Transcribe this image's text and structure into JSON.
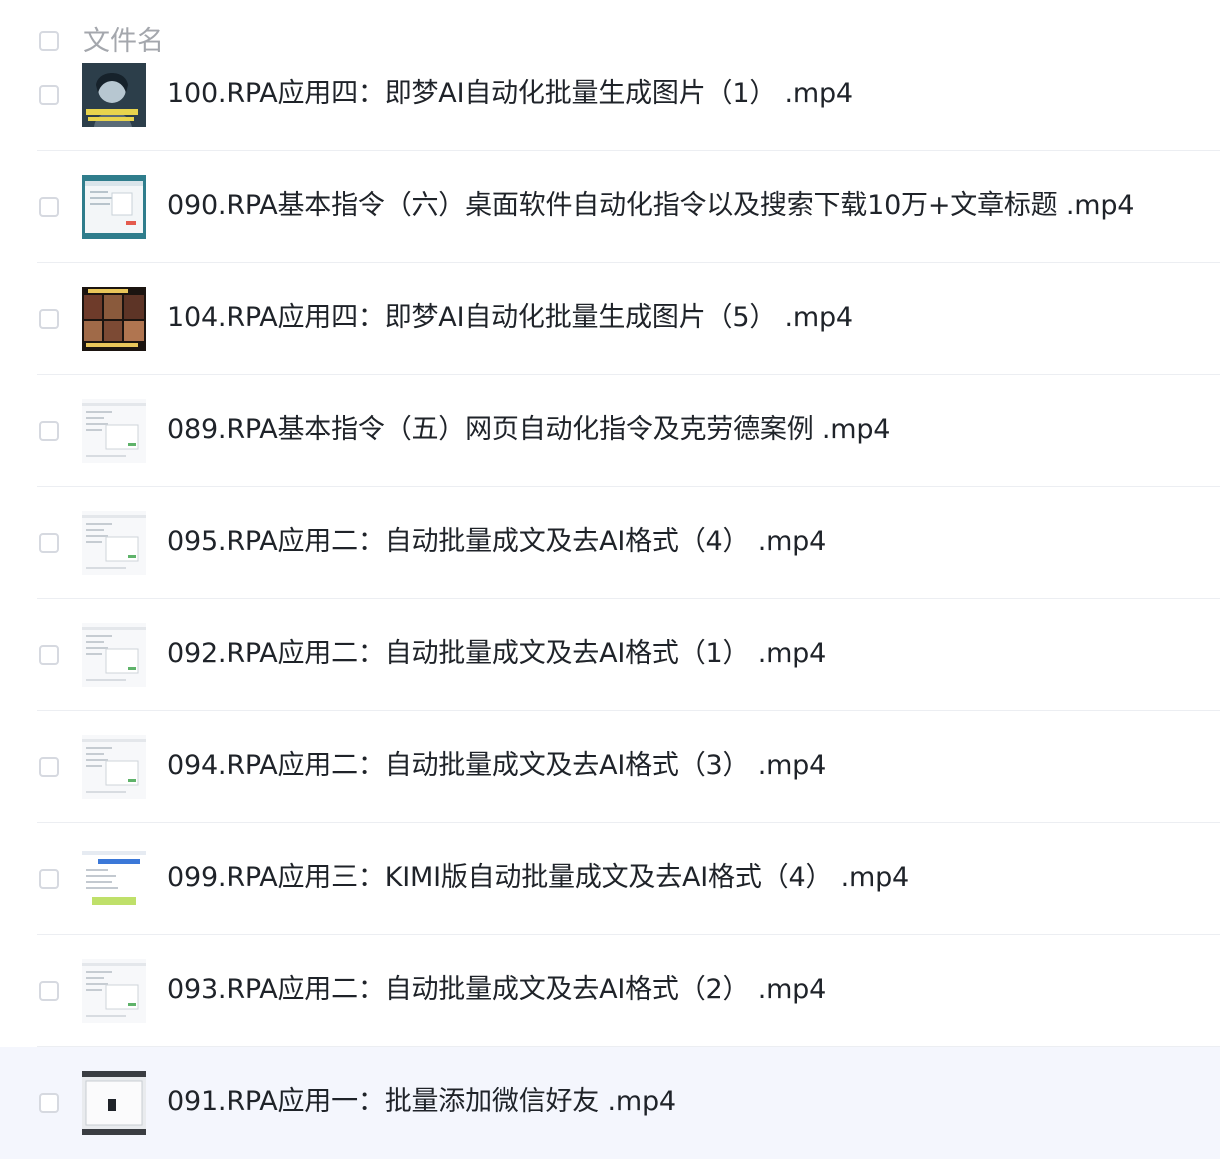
{
  "header": {
    "column_label": "文件名"
  },
  "files": [
    {
      "name": "100.RPA应用四：即梦AI自动化批量生成图片（1） .mp4",
      "thumbnail": "portrait-dark-thumbnail",
      "selected": false
    },
    {
      "name": "090.RPA基本指令（六）桌面软件自动化指令以及搜索下载10万+文章标题 .mp4",
      "thumbnail": "software-window-teal-thumbnail",
      "selected": false
    },
    {
      "name": "104.RPA应用四：即梦AI自动化批量生成图片（5） .mp4",
      "thumbnail": "image-grid-dark-thumbnail",
      "selected": false
    },
    {
      "name": "089.RPA基本指令（五）网页自动化指令及克劳德案例 .mp4",
      "thumbnail": "screen-capture-light-thumbnail",
      "selected": false
    },
    {
      "name": "095.RPA应用二：自动批量成文及去AI格式（4） .mp4",
      "thumbnail": "screen-capture-light-thumbnail",
      "selected": false
    },
    {
      "name": "092.RPA应用二：自动批量成文及去AI格式（1） .mp4",
      "thumbnail": "screen-capture-light-thumbnail",
      "selected": false
    },
    {
      "name": "094.RPA应用二：自动批量成文及去AI格式（3） .mp4",
      "thumbnail": "screen-capture-light-thumbnail",
      "selected": false
    },
    {
      "name": "099.RPA应用三：KIMI版自动批量成文及去AI格式（4） .mp4",
      "thumbnail": "screen-capture-blue-thumbnail",
      "selected": false
    },
    {
      "name": "093.RPA应用二：自动批量成文及去AI格式（2） .mp4",
      "thumbnail": "screen-capture-light-thumbnail",
      "selected": false
    },
    {
      "name": "091.RPA应用一：批量添加微信好友 .mp4",
      "thumbnail": "dialog-window-thumbnail",
      "selected": true
    }
  ],
  "colors": {
    "selected_row_bg": "#f4f6fd",
    "text": "#1f2329",
    "header_text": "#a4a7ad",
    "divider": "#eceef2",
    "checkbox_border": "#d6d9e0"
  }
}
